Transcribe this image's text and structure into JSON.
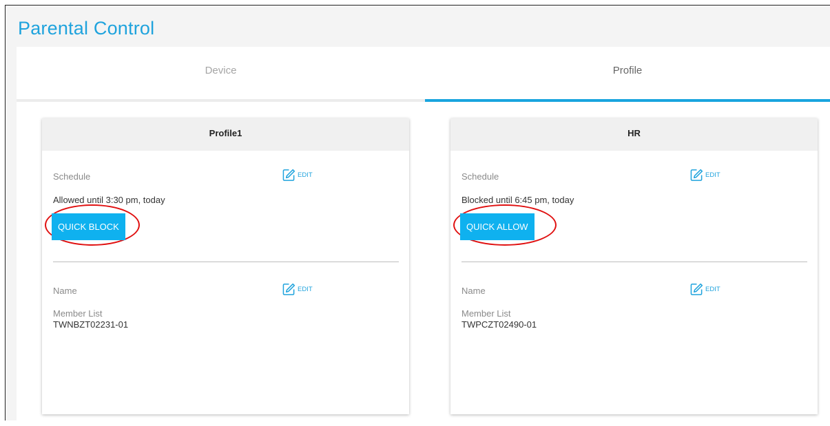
{
  "page": {
    "title": "Parental Control"
  },
  "tabs": [
    {
      "label": "Device",
      "active": false
    },
    {
      "label": "Profile",
      "active": true
    }
  ],
  "profiles": [
    {
      "name": "Profile1",
      "schedule_label": "Schedule",
      "schedule_status": "Allowed until 3:30 pm, today",
      "quick_button": "QUICK BLOCK",
      "name_label": "Name",
      "member_list_label": "Member List",
      "member": "TWNBZT02231-01",
      "edit_label": "EDIT"
    },
    {
      "name": "HR",
      "schedule_label": "Schedule",
      "schedule_status": "Blocked until 6:45 pm, today",
      "quick_button": "QUICK ALLOW",
      "name_label": "Name",
      "member_list_label": "Member List",
      "member": "TWPCZT02490-01",
      "edit_label": "EDIT"
    }
  ],
  "colors": {
    "accent": "#1fa3dd",
    "button": "#0fb1ef",
    "highlight_circle": "#e01010"
  },
  "icons": {
    "edit": "pencil-square-icon"
  }
}
